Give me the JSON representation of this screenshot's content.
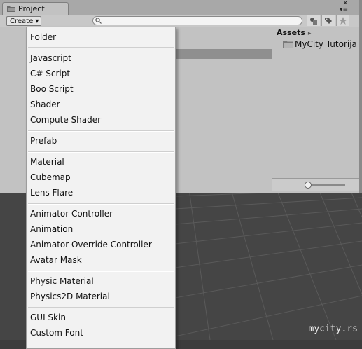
{
  "window": {
    "tab_title": "Project",
    "window_controls": "x\n+≡"
  },
  "toolbar": {
    "create_label": "Create ▾",
    "search_placeholder": ""
  },
  "assets_panel": {
    "title": "Assets",
    "arrow": "▸",
    "items": [
      {
        "label": "MyCity Tutorija"
      }
    ]
  },
  "create_menu": {
    "items": [
      {
        "label": "Folder"
      },
      {
        "label": "Javascript"
      },
      {
        "label": "C# Script"
      },
      {
        "label": "Boo Script"
      },
      {
        "label": "Shader"
      },
      {
        "label": "Compute Shader"
      },
      {
        "label": "Prefab"
      },
      {
        "label": "Material"
      },
      {
        "label": "Cubemap"
      },
      {
        "label": "Lens Flare"
      },
      {
        "label": "Animator Controller"
      },
      {
        "label": "Animation"
      },
      {
        "label": "Animator Override Controller"
      },
      {
        "label": "Avatar Mask"
      },
      {
        "label": "Physic Material"
      },
      {
        "label": "Physics2D Material"
      },
      {
        "label": "GUI Skin"
      },
      {
        "label": "Custom Font"
      }
    ]
  },
  "watermark": "mycity.rs",
  "colors": {
    "panel_bg": "#c2c2c2",
    "menu_bg": "#f2f2f2",
    "selection": "#8f8f8f",
    "scene_bg": "#454545"
  }
}
